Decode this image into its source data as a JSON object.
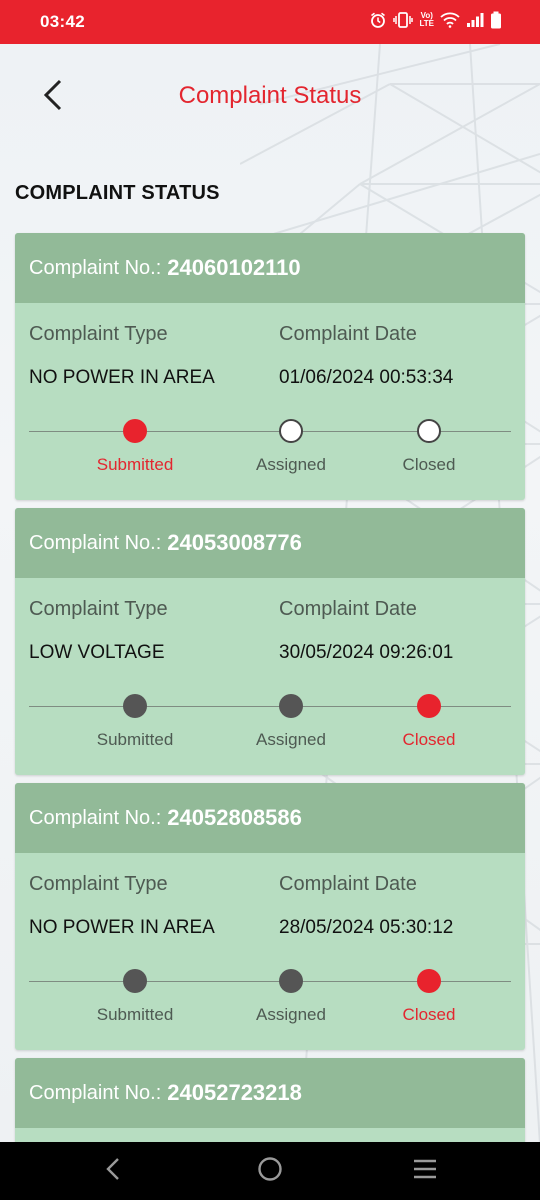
{
  "status_bar": {
    "time": "03:42",
    "volte_top": "Vo)",
    "volte_bottom": "LTE",
    "icons": [
      "alarm-icon",
      "vibrate-icon",
      "volte-icon",
      "wifi-icon",
      "signal-icon",
      "battery-icon"
    ]
  },
  "header": {
    "title": "Complaint Status",
    "back_icon": "chevron-left-icon"
  },
  "section_title": "COMPLAINT STATUS",
  "labels": {
    "complaint_no": "Complaint No.:",
    "complaint_type": "Complaint Type",
    "complaint_date": "Complaint Date",
    "steps": [
      "Submitted",
      "Assigned",
      "Closed"
    ]
  },
  "complaints": [
    {
      "number": "24060102110",
      "type": "NO POWER IN AREA",
      "date": "01/06/2024 00:53:34",
      "step_states": [
        "active",
        "pending",
        "pending"
      ]
    },
    {
      "number": "24053008776",
      "type": "LOW VOLTAGE",
      "date": "30/05/2024 09:26:01",
      "step_states": [
        "done",
        "done",
        "active"
      ]
    },
    {
      "number": "24052808586",
      "type": "NO POWER IN AREA",
      "date": "28/05/2024 05:30:12",
      "step_states": [
        "done",
        "done",
        "active"
      ]
    },
    {
      "number": "24052723218"
    }
  ],
  "colors": {
    "brand_red": "#e8232d",
    "card_header": "#92ba98",
    "card_body": "#b7ddc1"
  },
  "nav_bar": {
    "icons": [
      "nav-back-icon",
      "nav-home-icon",
      "nav-recents-icon"
    ]
  }
}
